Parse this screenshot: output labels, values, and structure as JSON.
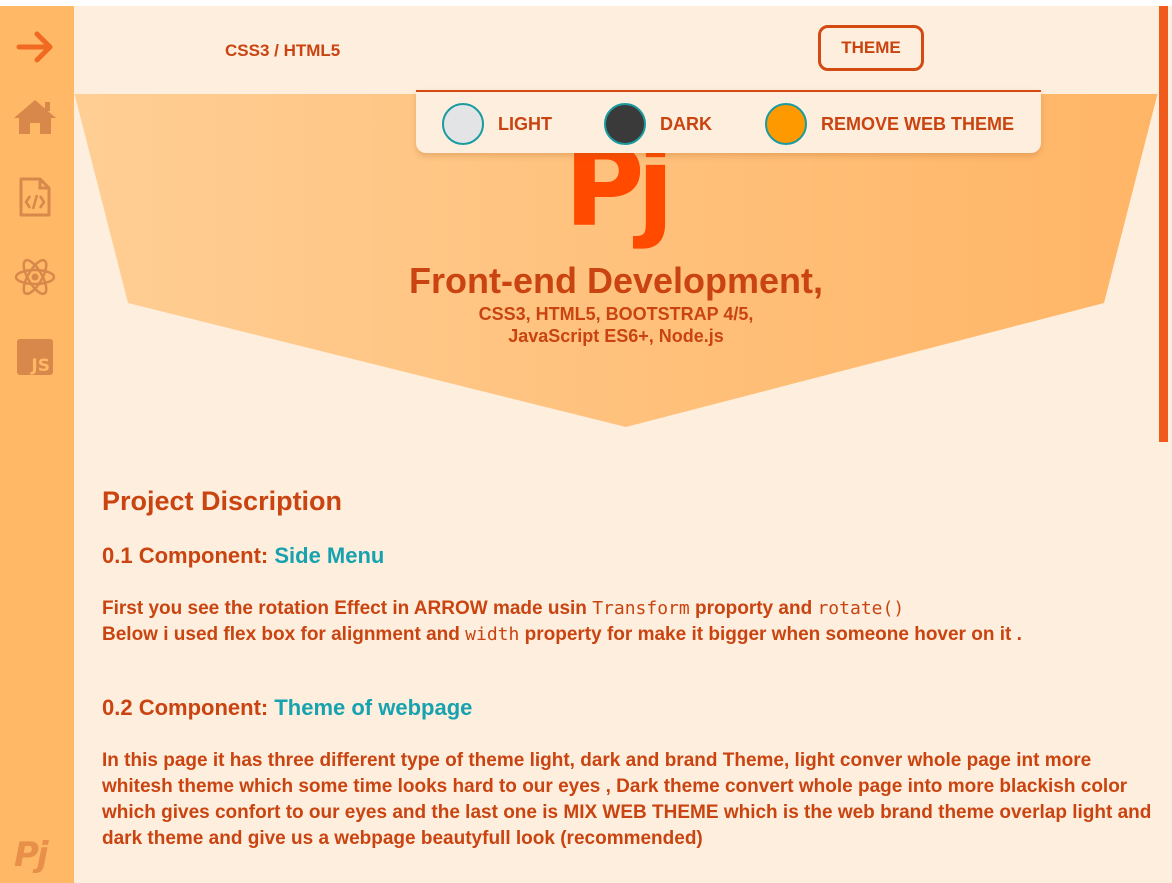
{
  "header": {
    "brand_link": "CSS3 / HTML5",
    "theme_button": "THEME"
  },
  "theme_menu": {
    "options": [
      {
        "label": "LIGHT",
        "color": "#e2e4e6"
      },
      {
        "label": "DARK",
        "color": "#3a3a3a"
      },
      {
        "label": "REMOVE WEB THEME",
        "color": "#ff9900"
      }
    ]
  },
  "hero": {
    "logo": "Pj",
    "title": "Front-end Development,",
    "subtitle_line1": "CSS3, HTML5, BOOTSTRAP 4/5,",
    "subtitle_line2": "JavaScript ES6+, Node.js"
  },
  "sidebar": {
    "icons": [
      "arrow-right-icon",
      "home-icon",
      "code-file-icon",
      "react-icon",
      "js-icon"
    ],
    "logo": "Pj"
  },
  "content": {
    "heading": "Project Discription",
    "component1": {
      "prefix": "0.1 Component: ",
      "name": "Side Menu",
      "line1_a": "First you see the rotation Effect in ARROW made usin ",
      "line1_code1": "Transform",
      "line1_b": " proporty and ",
      "line1_code2": "rotate()",
      "line2_a": "Below i used flex box for alignment and ",
      "line2_code": "width",
      "line2_b": " property for make it bigger when someone hover on it ."
    },
    "component2": {
      "prefix": "0.2 Component: ",
      "name": "Theme of webpage",
      "text": "In this page it has three different type of theme light, dark and brand Theme, light conver whole page int more whitesh theme which some time looks hard to our eyes , Dark theme convert whole page into more blackish color which gives confort to our eyes and the last one is MIX WEB THEME which is the web brand theme overlap light and dark theme and give us a webpage beautyfull look (recommended)"
    }
  },
  "colors": {
    "accent": "#c94410",
    "sidebar": "#ffb866",
    "link": "#17a2b0",
    "background": "#fdeedd"
  }
}
